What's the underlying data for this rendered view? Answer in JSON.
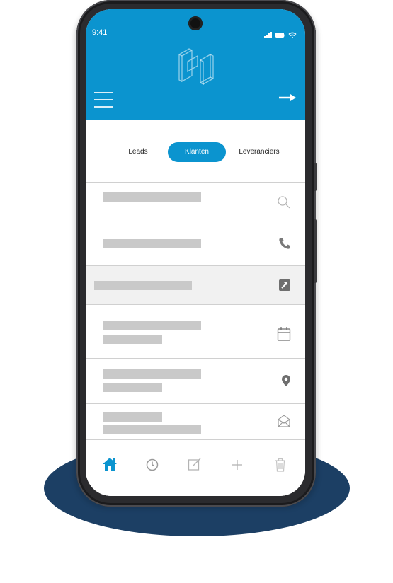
{
  "status_bar": {
    "time": "9:41",
    "icons": [
      "signal-icon",
      "battery-icon",
      "wifi-icon"
    ]
  },
  "header": {
    "logo": "app-logo",
    "menu_icon": "hamburger-menu-icon",
    "action_icon": "arrow-right-icon",
    "color": "#0b94cf"
  },
  "tabs": [
    {
      "label": "Leads",
      "active": false
    },
    {
      "label": "Klanten",
      "active": true
    },
    {
      "label": "Leveranciers",
      "active": false
    }
  ],
  "list_rows": [
    {
      "icon": "search-icon",
      "selected": false
    },
    {
      "icon": "phone-icon",
      "selected": false
    },
    {
      "icon": "external-link-icon",
      "selected": true
    },
    {
      "icon": "calendar-icon",
      "selected": false
    },
    {
      "icon": "map-pin-icon",
      "selected": false
    },
    {
      "icon": "mail-icon",
      "selected": false
    }
  ],
  "bottom_nav": [
    {
      "icon": "home-icon",
      "active": true
    },
    {
      "icon": "clock-icon",
      "active": false
    },
    {
      "icon": "edit-icon",
      "active": false
    },
    {
      "icon": "plus-icon",
      "active": false
    },
    {
      "icon": "trash-icon",
      "active": false
    }
  ],
  "colors": {
    "accent": "#0b94cf",
    "pedestal": "#1c3f64",
    "placeholder": "#c9c9c9",
    "icon_gray": "#b3b3b3"
  }
}
